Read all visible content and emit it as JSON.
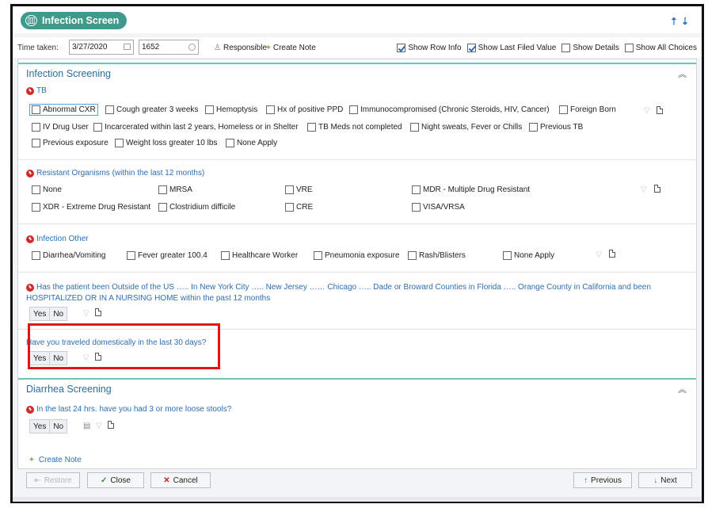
{
  "window": {
    "title": "Infection Screen"
  },
  "toolbar": {
    "time_label": "Time taken:",
    "date_value": "3/27/2020",
    "time_value": "1652",
    "responsible_label": "Responsible",
    "create_note_label": "Create Note",
    "show_options": [
      {
        "label": "Show Row Info",
        "checked": true
      },
      {
        "label": "Show Last Filed Value",
        "checked": true
      },
      {
        "label": "Show Details",
        "checked": false
      },
      {
        "label": "Show All Choices",
        "checked": false
      }
    ]
  },
  "infection": {
    "heading": "Infection Screening",
    "tb": {
      "label": "TB",
      "options": [
        "Abnormal CXR",
        "Cough greater 3 weeks",
        "Hemoptysis",
        "Hx of positive PPD",
        "Immunocompromised (Chronic Steroids, HIV, Cancer)",
        "Foreign Born",
        "IV Drug User",
        "Incarcerated within last 2 years, Homeless or in Shelter",
        "TB Meds not completed",
        "Night sweats, Fever or Chills",
        "Previous TB",
        "Previous exposure",
        "Weight loss greater 10 lbs",
        "None Apply"
      ]
    },
    "resistant": {
      "label": "Resistant Organisms (within the last 12 months)",
      "options": [
        "None",
        "MRSA",
        "VRE",
        "MDR - Multiple Drug Resistant",
        "XDR - Extreme Drug Resistant",
        "Clostridium difficile",
        "CRE",
        "VISA/VRSA"
      ]
    },
    "other": {
      "label": "Infection Other",
      "options": [
        "Diarrhea/Vomiting",
        "Fever greater 100.4",
        "Healthcare Worker",
        "Pneumonia exposure",
        "Rash/Blisters",
        "None Apply"
      ]
    },
    "outside_us": {
      "line1": "Has the patient been Outside of the US ….. In New York City ….. New Jersey …… Chicago ….. Dade or Broward Counties in Florida ….. Orange County in California and been",
      "line2": "HOSPITALIZED OR IN A NURSING HOME within the past 12 months",
      "yes": "Yes",
      "no": "No"
    },
    "domestic": {
      "label": "Have you traveled domestically in the last 30 days?",
      "yes": "Yes",
      "no": "No"
    }
  },
  "diarrhea": {
    "heading": "Diarrhea Screening",
    "question": "In the last 24 hrs. have you had 3 or more loose stools?",
    "yes": "Yes",
    "no": "No",
    "create_note_label": "Create Note"
  },
  "footer": {
    "restore": "Restore",
    "close": "Close",
    "cancel": "Cancel",
    "previous": "Previous",
    "next": "Next"
  }
}
